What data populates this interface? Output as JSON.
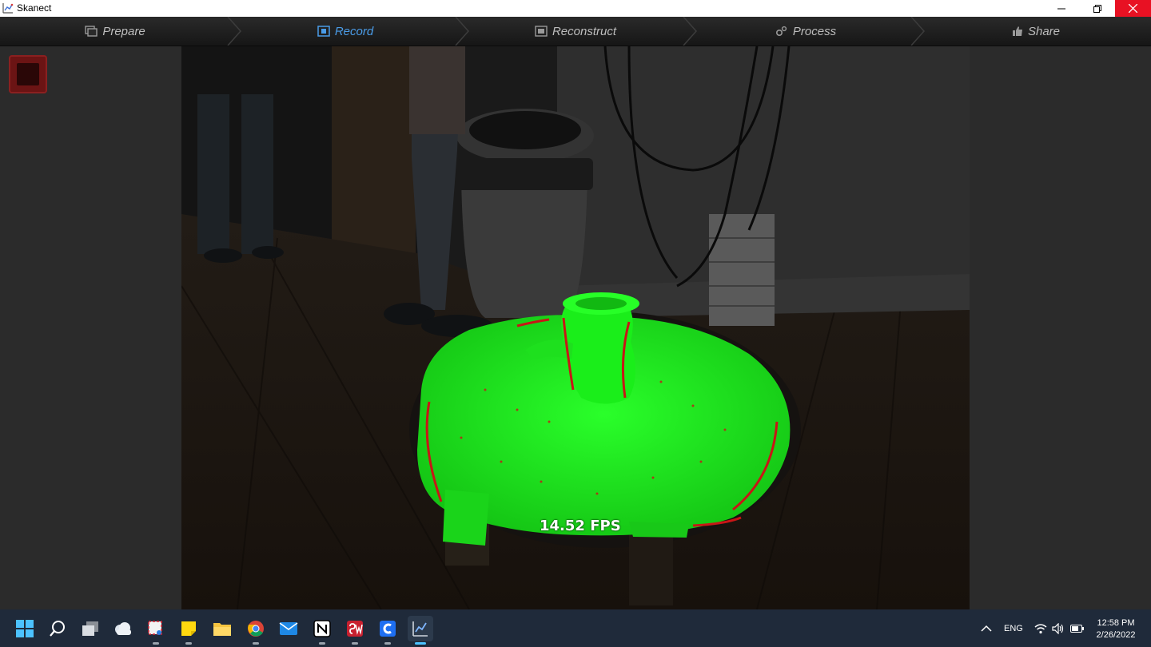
{
  "window": {
    "title": "Skanect",
    "minimize_icon": "minimize-icon",
    "maximize_icon": "restore-icon",
    "close_icon": "close-icon",
    "close_color": "#e81123"
  },
  "nav": {
    "tabs": [
      {
        "label": "Prepare",
        "icon": "prepare-icon",
        "active": false
      },
      {
        "label": "Record",
        "icon": "record-tab-icon",
        "active": true
      },
      {
        "label": "Reconstruct",
        "icon": "film-icon",
        "active": false
      },
      {
        "label": "Process",
        "icon": "gears-icon",
        "active": false
      },
      {
        "label": "Share",
        "icon": "thumbs-up-icon",
        "active": false
      }
    ],
    "active_color": "#4a9ce8"
  },
  "left_panel": {
    "record_button_icon": "stop-record-icon",
    "record_button_color": "#6b1414"
  },
  "viewport": {
    "fps_label": "14.52 FPS",
    "mesh_color": "#18d418"
  },
  "taskbar": {
    "icons": [
      "windows-start-icon",
      "search-icon",
      "task-view-icon",
      "weather-icon",
      "snipping-tool-icon",
      "sticky-notes-icon",
      "file-explorer-icon",
      "chrome-icon",
      "mail-icon",
      "notion-icon",
      "solidworks-icon",
      "cura-icon",
      "skanect-icon"
    ],
    "tray": {
      "chevron_icon": "chevron-up-icon",
      "language": "ENG",
      "wifi_icon": "wifi-icon",
      "volume_icon": "volume-icon",
      "battery_icon": "battery-icon"
    },
    "clock": {
      "time": "12:58 PM",
      "date": "2/26/2022"
    }
  }
}
